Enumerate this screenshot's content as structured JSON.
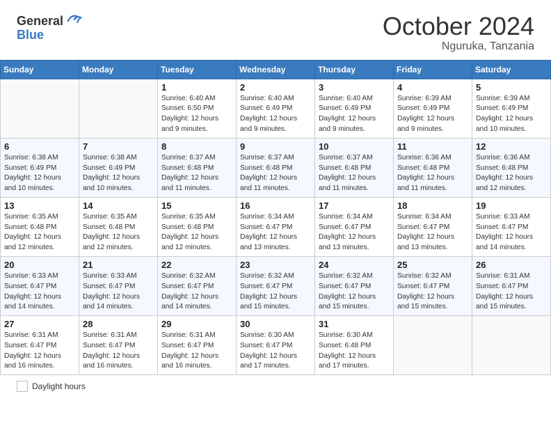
{
  "header": {
    "logo_general": "General",
    "logo_blue": "Blue",
    "month_title": "October 2024",
    "location": "Nguruka, Tanzania"
  },
  "calendar": {
    "days_of_week": [
      "Sunday",
      "Monday",
      "Tuesday",
      "Wednesday",
      "Thursday",
      "Friday",
      "Saturday"
    ],
    "weeks": [
      [
        {
          "day": "",
          "info": ""
        },
        {
          "day": "",
          "info": ""
        },
        {
          "day": "1",
          "info": "Sunrise: 6:40 AM\nSunset: 6:50 PM\nDaylight: 12 hours\nand 9 minutes."
        },
        {
          "day": "2",
          "info": "Sunrise: 6:40 AM\nSunset: 6:49 PM\nDaylight: 12 hours\nand 9 minutes."
        },
        {
          "day": "3",
          "info": "Sunrise: 6:40 AM\nSunset: 6:49 PM\nDaylight: 12 hours\nand 9 minutes."
        },
        {
          "day": "4",
          "info": "Sunrise: 6:39 AM\nSunset: 6:49 PM\nDaylight: 12 hours\nand 9 minutes."
        },
        {
          "day": "5",
          "info": "Sunrise: 6:39 AM\nSunset: 6:49 PM\nDaylight: 12 hours\nand 10 minutes."
        }
      ],
      [
        {
          "day": "6",
          "info": "Sunrise: 6:38 AM\nSunset: 6:49 PM\nDaylight: 12 hours\nand 10 minutes."
        },
        {
          "day": "7",
          "info": "Sunrise: 6:38 AM\nSunset: 6:49 PM\nDaylight: 12 hours\nand 10 minutes."
        },
        {
          "day": "8",
          "info": "Sunrise: 6:37 AM\nSunset: 6:48 PM\nDaylight: 12 hours\nand 11 minutes."
        },
        {
          "day": "9",
          "info": "Sunrise: 6:37 AM\nSunset: 6:48 PM\nDaylight: 12 hours\nand 11 minutes."
        },
        {
          "day": "10",
          "info": "Sunrise: 6:37 AM\nSunset: 6:48 PM\nDaylight: 12 hours\nand 11 minutes."
        },
        {
          "day": "11",
          "info": "Sunrise: 6:36 AM\nSunset: 6:48 PM\nDaylight: 12 hours\nand 11 minutes."
        },
        {
          "day": "12",
          "info": "Sunrise: 6:36 AM\nSunset: 6:48 PM\nDaylight: 12 hours\nand 12 minutes."
        }
      ],
      [
        {
          "day": "13",
          "info": "Sunrise: 6:35 AM\nSunset: 6:48 PM\nDaylight: 12 hours\nand 12 minutes."
        },
        {
          "day": "14",
          "info": "Sunrise: 6:35 AM\nSunset: 6:48 PM\nDaylight: 12 hours\nand 12 minutes."
        },
        {
          "day": "15",
          "info": "Sunrise: 6:35 AM\nSunset: 6:48 PM\nDaylight: 12 hours\nand 12 minutes."
        },
        {
          "day": "16",
          "info": "Sunrise: 6:34 AM\nSunset: 6:47 PM\nDaylight: 12 hours\nand 13 minutes."
        },
        {
          "day": "17",
          "info": "Sunrise: 6:34 AM\nSunset: 6:47 PM\nDaylight: 12 hours\nand 13 minutes."
        },
        {
          "day": "18",
          "info": "Sunrise: 6:34 AM\nSunset: 6:47 PM\nDaylight: 12 hours\nand 13 minutes."
        },
        {
          "day": "19",
          "info": "Sunrise: 6:33 AM\nSunset: 6:47 PM\nDaylight: 12 hours\nand 14 minutes."
        }
      ],
      [
        {
          "day": "20",
          "info": "Sunrise: 6:33 AM\nSunset: 6:47 PM\nDaylight: 12 hours\nand 14 minutes."
        },
        {
          "day": "21",
          "info": "Sunrise: 6:33 AM\nSunset: 6:47 PM\nDaylight: 12 hours\nand 14 minutes."
        },
        {
          "day": "22",
          "info": "Sunrise: 6:32 AM\nSunset: 6:47 PM\nDaylight: 12 hours\nand 14 minutes."
        },
        {
          "day": "23",
          "info": "Sunrise: 6:32 AM\nSunset: 6:47 PM\nDaylight: 12 hours\nand 15 minutes."
        },
        {
          "day": "24",
          "info": "Sunrise: 6:32 AM\nSunset: 6:47 PM\nDaylight: 12 hours\nand 15 minutes."
        },
        {
          "day": "25",
          "info": "Sunrise: 6:32 AM\nSunset: 6:47 PM\nDaylight: 12 hours\nand 15 minutes."
        },
        {
          "day": "26",
          "info": "Sunrise: 6:31 AM\nSunset: 6:47 PM\nDaylight: 12 hours\nand 15 minutes."
        }
      ],
      [
        {
          "day": "27",
          "info": "Sunrise: 6:31 AM\nSunset: 6:47 PM\nDaylight: 12 hours\nand 16 minutes."
        },
        {
          "day": "28",
          "info": "Sunrise: 6:31 AM\nSunset: 6:47 PM\nDaylight: 12 hours\nand 16 minutes."
        },
        {
          "day": "29",
          "info": "Sunrise: 6:31 AM\nSunset: 6:47 PM\nDaylight: 12 hours\nand 16 minutes."
        },
        {
          "day": "30",
          "info": "Sunrise: 6:30 AM\nSunset: 6:47 PM\nDaylight: 12 hours\nand 17 minutes."
        },
        {
          "day": "31",
          "info": "Sunrise: 6:30 AM\nSunset: 6:48 PM\nDaylight: 12 hours\nand 17 minutes."
        },
        {
          "day": "",
          "info": ""
        },
        {
          "day": "",
          "info": ""
        }
      ]
    ]
  },
  "footer": {
    "legend_label": "Daylight hours"
  }
}
